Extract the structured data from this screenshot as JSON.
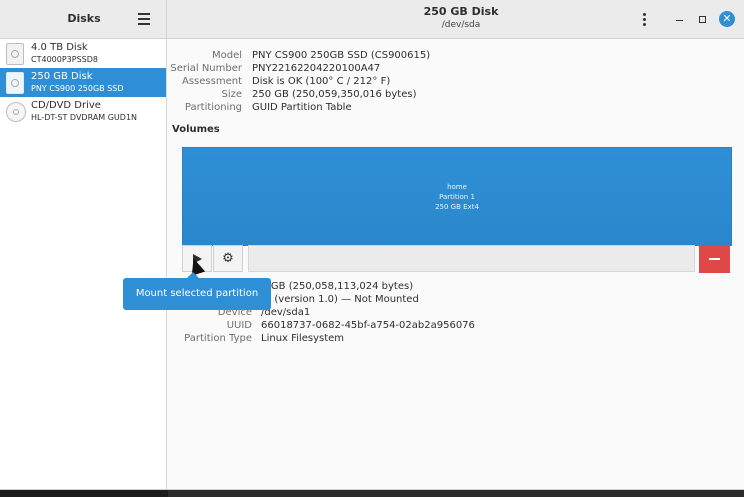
{
  "sidebar": {
    "title": "Disks",
    "items": [
      {
        "name": "4.0 TB Disk",
        "model": "CT4000P3PSSD8"
      },
      {
        "name": "250 GB Disk",
        "model": "PNY CS900 250GB SSD",
        "selected": true
      },
      {
        "name": "CD/DVD Drive",
        "model": "HL-DT-ST DVDRAM GUD1N"
      }
    ]
  },
  "header": {
    "title": "250 GB Disk",
    "subtitle": "/dev/sda",
    "menu_icon": "hamburger-menu-icon",
    "kebab_icon": "vertical-dots-icon",
    "accent_color": "#2f8fd6"
  },
  "disk_info": {
    "model_label": "Model",
    "model_value": "PNY CS900 250GB SSD (CS900615)",
    "serial_label": "Serial Number",
    "serial_value": "PNY22162204220100A47",
    "assessment_label": "Assessment",
    "assessment_value": "Disk is OK (100° C / 212° F)",
    "size_label": "Size",
    "size_value": "250 GB (250,059,350,016 bytes)",
    "partitioning_label": "Partitioning",
    "partitioning_value": "GUID Partition Table"
  },
  "volumes": {
    "heading": "Volumes",
    "partition": {
      "line1": "home",
      "line2": "Partition 1",
      "line3": "250 GB Ext4",
      "color": "#2f8fd6"
    },
    "delete_color": "#e04848"
  },
  "partition_info": {
    "size_value": "50 GB (250,058,113,024 bytes)",
    "contents_value": "xt4 (version 1.0) — Not Mounted",
    "device_label": "Device",
    "device_value": "/dev/sda1",
    "uuid_label": "UUID",
    "uuid_value": "66018737-0682-45bf-a754-02ab2a956076",
    "type_label": "Partition Type",
    "type_value": "Linux Filesystem"
  },
  "tooltip": {
    "text": "Mount selected partition"
  }
}
